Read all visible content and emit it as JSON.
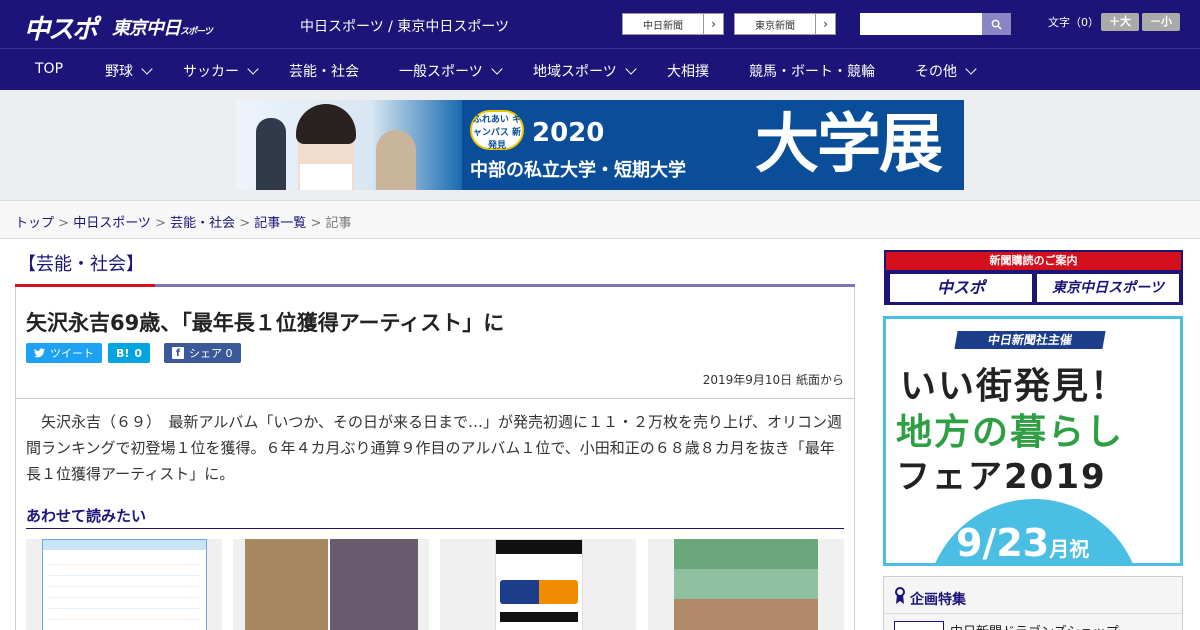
{
  "header": {
    "logo_main": "中スポ",
    "logo_tokyo": "東京中日",
    "logo_tokyo_small": "スポーツ",
    "site_title": "中日スポーツ / 東京中日スポーツ",
    "links": [
      "中日新聞",
      "東京新聞"
    ],
    "search_placeholder": "",
    "font_label": "文字（0）",
    "font_larger": "＋大",
    "font_smaller": "－小"
  },
  "nav": {
    "items": [
      {
        "label": "TOP"
      },
      {
        "label": "野球"
      },
      {
        "label": "サッカー"
      },
      {
        "label": "芸能・社会"
      },
      {
        "label": "一般スポーツ"
      },
      {
        "label": "地域スポーツ"
      },
      {
        "label": "大相撲"
      },
      {
        "label": "競馬・ボート・競輪"
      },
      {
        "label": "その他"
      }
    ]
  },
  "ad_banner": {
    "badge": "ふれあい キャンパス 新発見",
    "year": "2020",
    "subtitle": "中部の私立大学・短期大学",
    "headline": "大学展"
  },
  "breadcrumb": [
    "トップ",
    "中日スポーツ",
    "芸能・社会",
    "記事一覧",
    "記事"
  ],
  "article": {
    "category": "【芸能・社会】",
    "headline": "矢沢永吉69歳、「最年長１位獲得アーティスト」に",
    "share_tweet": "ツイート",
    "share_hatena": "0",
    "share_facebook": "シェア 0",
    "dateline": "2019年9月10日 紙面から",
    "body": "矢沢永吉（６９）　最新アルバム「いつか、その日が来る日まで…」が発売初週に１１・２万枚を売り上げ、オリコン週間ランキングで初登場１位を獲得。６年４カ月ぶり通算９作目のアルバム１位で、小田和正の６８歳８カ月を抜き「最年長１位獲得アーティスト」に。",
    "related_heading": "あわせて読みたい"
  },
  "sidebar": {
    "subscribe_label": "新聞購読のご案内",
    "subscribe_logos": [
      "中スポ",
      "東京中日スポーツ"
    ],
    "fair": {
      "organizer": "中日新聞社主催",
      "line1": "いい街発見！",
      "line2": "地方の暮らし",
      "line3": "フェア2019",
      "date": "9/23",
      "date_suffix": "月祝"
    },
    "features_heading": "企画特集",
    "features_item": "中日新聞ドラゴンズショップ"
  }
}
